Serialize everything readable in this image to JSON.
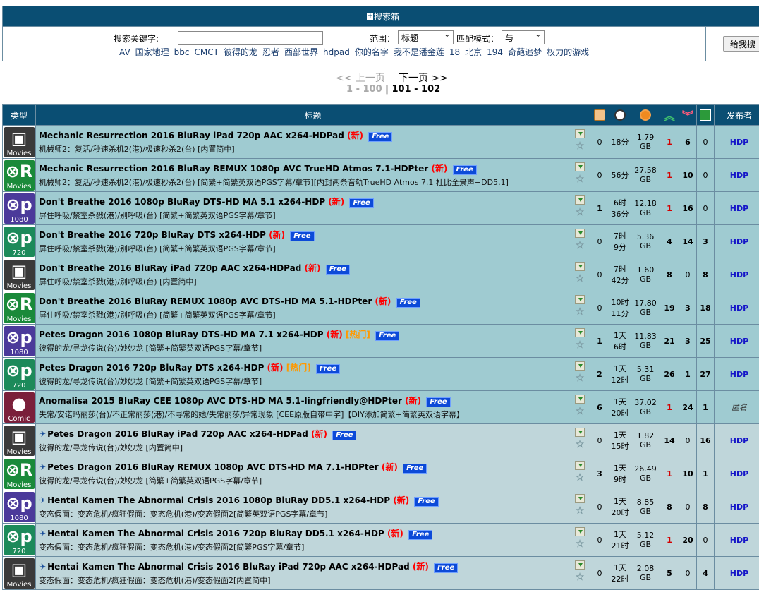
{
  "search": {
    "header": "搜索箱",
    "keyword_label": "搜索关键字:",
    "keyword_value": "",
    "scope_label": "范围：",
    "scope_value": "标题",
    "match_label": "匹配模式：",
    "match_value": "与",
    "button_label": "给我搜",
    "quick_links": [
      "AV",
      "国家地理",
      "bbc",
      "CMCT",
      "彼得的龙",
      "忍者",
      "西部世界",
      "hdpad",
      "你的名字",
      "我不是潘金莲",
      "18",
      "北京",
      "194",
      "奇葩追梦",
      "权力的游戏"
    ]
  },
  "pager": {
    "prev": "<< 上一页",
    "next": "下一页 >>",
    "range_current": "1 - 100",
    "separator": " | ",
    "range_next": "101 - 102"
  },
  "table": {
    "headers": {
      "type": "类型",
      "title": "标题",
      "uploader": "发布者",
      "comments_icon": "comment-icon",
      "time_icon": "clock-icon",
      "size_icon": "disc-icon",
      "seeders_icon": "seeders-up-icon",
      "leechers_icon": "leechers-down-icon",
      "completed_icon": "completed-check-icon"
    },
    "rows": [
      {
        "cat": "Movies",
        "cat_class": "cat-movies",
        "glyph": "▣",
        "pin": false,
        "title": "Mechanic Resurrection 2016 BluRay iPad 720p AAC x264-HDPad",
        "new": "(新)",
        "hot": "",
        "free": "Free",
        "sub": "机械师2：复活/秒速杀机2(港)/极速秒杀2(台) [内置简中]",
        "comments": "0",
        "time": "18分",
        "size1": "1.79",
        "size2": "GB",
        "seeders": "1",
        "seeders_red": true,
        "leechers": "6",
        "completed": "0",
        "uploader": "HDP",
        "anon": false,
        "hl": true
      },
      {
        "cat": "Movies",
        "cat_class": "cat-remux",
        "glyph": "⊗R",
        "pin": false,
        "title": "Mechanic Resurrection 2016 BluRay REMUX 1080p AVC TrueHD Atmos 7.1-HDPter",
        "new": "(新)",
        "hot": "",
        "free": "Free",
        "sub": "机械师2：复活/秒速杀机2(港)/极速秒杀2(台) [简繁+简繁英双语PGS字幕/章节][内封两条音轨TrueHD Atmos 7.1 杜比全景声+DD5.1]",
        "comments": "0",
        "time": "56分",
        "size1": "27.58",
        "size2": "GB",
        "seeders": "1",
        "seeders_red": true,
        "leechers": "10",
        "completed": "0",
        "uploader": "HDP",
        "anon": false,
        "hl": true
      },
      {
        "cat": "1080",
        "cat_class": "cat-1080",
        "glyph": "⊗p",
        "pin": false,
        "title": "Don't Breathe 2016 1080p BluRay DTS-HD MA 5.1 x264-HDP",
        "new": "(新)",
        "hot": "",
        "free": "Free",
        "sub": "屏住呼吸/禁室杀戮(港)/别呼吸(台) [简繁+简繁英双语PGS字幕/章节]",
        "comments": "1",
        "time": "6时",
        "time2": "36分",
        "size1": "12.18",
        "size2": "GB",
        "seeders": "1",
        "seeders_red": true,
        "leechers": "16",
        "completed": "0",
        "uploader": "HDP",
        "anon": false,
        "hl": true
      },
      {
        "cat": "720",
        "cat_class": "cat-720",
        "glyph": "⊗p",
        "pin": false,
        "title": "Don't Breathe 2016 720p BluRay DTS x264-HDP",
        "new": "(新)",
        "hot": "",
        "free": "Free",
        "sub": "屏住呼吸/禁室杀戮(港)/别呼吸(台) [简繁+简繁英双语PGS字幕/章节]",
        "comments": "0",
        "time": "7时",
        "time2": "9分",
        "size1": "5.36",
        "size2": "GB",
        "seeders": "4",
        "seeders_red": false,
        "leechers": "14",
        "completed": "3",
        "uploader": "HDP",
        "anon": false,
        "hl": true
      },
      {
        "cat": "Movies",
        "cat_class": "cat-movies",
        "glyph": "▣",
        "pin": false,
        "title": "Don't Breathe 2016 BluRay iPad 720p AAC x264-HDPad",
        "new": "(新)",
        "hot": "",
        "free": "Free",
        "sub": "屏住呼吸/禁室杀戮(港)/别呼吸(台) [内置简中]",
        "comments": "0",
        "time": "7时",
        "time2": "42分",
        "size1": "1.60",
        "size2": "GB",
        "seeders": "8",
        "seeders_red": false,
        "leechers": "0",
        "completed": "8",
        "uploader": "HDP",
        "anon": false,
        "hl": true
      },
      {
        "cat": "Movies",
        "cat_class": "cat-remux",
        "glyph": "⊗R",
        "pin": false,
        "title": "Don't Breathe 2016 BluRay REMUX 1080p AVC DTS-HD MA 5.1-HDPter",
        "new": "(新)",
        "hot": "",
        "free": "Free",
        "sub": "屏住呼吸/禁室杀戮(港)/别呼吸(台) [简繁+简繁英双语PGS字幕/章节]",
        "comments": "0",
        "time": "10时",
        "time2": "11分",
        "size1": "17.80",
        "size2": "GB",
        "seeders": "19",
        "seeders_red": false,
        "leechers": "3",
        "completed": "18",
        "uploader": "HDP",
        "anon": false,
        "hl": true
      },
      {
        "cat": "1080",
        "cat_class": "cat-1080",
        "glyph": "⊗p",
        "pin": false,
        "title": "Petes Dragon 2016 1080p BluRay DTS-HD MA 7.1 x264-HDP",
        "new": "(新)",
        "hot": "[热门]",
        "free": "Free",
        "sub": "彼得的龙/寻龙传说(台)/妙妙龙 [简繁+简繁英双语PGS字幕/章节]",
        "comments": "1",
        "time": "1天",
        "time2": "6时",
        "size1": "11.83",
        "size2": "GB",
        "seeders": "21",
        "seeders_red": false,
        "leechers": "3",
        "completed": "25",
        "uploader": "HDP",
        "anon": false,
        "hl": true
      },
      {
        "cat": "720",
        "cat_class": "cat-720",
        "glyph": "⊗p",
        "pin": false,
        "title": "Petes Dragon 2016 720p BluRay DTS x264-HDP",
        "new": "(新)",
        "hot": "[热门]",
        "free": "Free",
        "sub": "彼得的龙/寻龙传说(台)/妙妙龙 [简繁+简繁英双语PGS字幕/章节]",
        "comments": "2",
        "time": "1天",
        "time2": "12时",
        "size1": "5.31",
        "size2": "GB",
        "seeders": "26",
        "seeders_red": false,
        "leechers": "1",
        "completed": "27",
        "uploader": "HDP",
        "anon": false,
        "hl": true
      },
      {
        "cat": "Comic",
        "cat_class": "cat-comic",
        "glyph": "●",
        "pin": false,
        "title": "Anomalisa 2015 BluRay CEE 1080p AVC DTS-HD MA 5.1-lingfriendly@HDPter",
        "new": "(新)",
        "hot": "",
        "free": "Free",
        "sub": "失常/安诺玛丽莎(台)/不正常丽莎(港)/不寻常的她/失常丽莎/异常现象 [CEE原版自带中字]【DIY添加简繁+简繁英双语字幕】",
        "comments": "6",
        "time": "1天",
        "time2": "20时",
        "size1": "37.02",
        "size2": "GB",
        "seeders": "1",
        "seeders_red": true,
        "leechers": "24",
        "completed": "1",
        "uploader": "匿名",
        "anon": true,
        "hl": true
      },
      {
        "cat": "Movies",
        "cat_class": "cat-movies",
        "glyph": "▣",
        "pin": true,
        "title": "Petes Dragon 2016 BluRay iPad 720p AAC x264-HDPad",
        "new": "(新)",
        "hot": "",
        "free": "Free",
        "sub": "彼得的龙/寻龙传说(台)/妙妙龙 [内置简中]",
        "comments": "0",
        "time": "1天",
        "time2": "15时",
        "size1": "1.82",
        "size2": "GB",
        "seeders": "14",
        "seeders_red": false,
        "leechers": "0",
        "completed": "16",
        "uploader": "HDP",
        "anon": false,
        "hl": false
      },
      {
        "cat": "Movies",
        "cat_class": "cat-remux",
        "glyph": "⊗R",
        "pin": true,
        "title": "Petes Dragon 2016 BluRay REMUX 1080p AVC DTS-HD MA 7.1-HDPter",
        "new": "(新)",
        "hot": "",
        "free": "Free",
        "sub": "彼得的龙/寻龙传说(台)/妙妙龙 [简繁+简繁英双语PGS字幕/章节]",
        "comments": "3",
        "time": "1天",
        "time2": "9时",
        "size1": "26.49",
        "size2": "GB",
        "seeders": "1",
        "seeders_red": true,
        "leechers": "10",
        "completed": "1",
        "uploader": "HDP",
        "anon": false,
        "hl": false
      },
      {
        "cat": "1080",
        "cat_class": "cat-1080",
        "glyph": "⊗p",
        "pin": true,
        "title": "Hentai Kamen The Abnormal Crisis 2016 1080p BluRay DD5.1 x264-HDP",
        "new": "(新)",
        "hot": "",
        "free": "Free",
        "sub": "变态假面：变态危机/疯狂假面：变态危机(港)/变态假面2[简繁英双语PGS字幕/章节]",
        "comments": "0",
        "time": "1天",
        "time2": "20时",
        "size1": "8.85",
        "size2": "GB",
        "seeders": "8",
        "seeders_red": false,
        "leechers": "0",
        "completed": "8",
        "uploader": "HDP",
        "anon": false,
        "hl": false
      },
      {
        "cat": "720",
        "cat_class": "cat-720",
        "glyph": "⊗p",
        "pin": true,
        "title": "Hentai Kamen The Abnormal Crisis 2016 720p BluRay DD5.1 x264-HDP",
        "new": "(新)",
        "hot": "",
        "free": "Free",
        "sub": "变态假面：变态危机/疯狂假面：变态危机(港)/变态假面2[简繁PGS字幕/章节]",
        "comments": "0",
        "time": "1天",
        "time2": "21时",
        "size1": "5.12",
        "size2": "GB",
        "seeders": "1",
        "seeders_red": true,
        "leechers": "20",
        "completed": "0",
        "uploader": "HDP",
        "anon": false,
        "hl": false
      },
      {
        "cat": "Movies",
        "cat_class": "cat-movies",
        "glyph": "▣",
        "pin": true,
        "title": "Hentai Kamen The Abnormal Crisis 2016 BluRay iPad 720p AAC x264-HDPad",
        "new": "(新)",
        "hot": "",
        "free": "Free",
        "sub": "变态假面：变态危机/疯狂假面：变态危机(港)/变态假面2[内置简中]",
        "comments": "0",
        "time": "1天",
        "time2": "22时",
        "size1": "2.08",
        "size2": "GB",
        "seeders": "5",
        "seeders_red": false,
        "leechers": "0",
        "completed": "4",
        "uploader": "HDP",
        "anon": false,
        "hl": false
      }
    ]
  }
}
